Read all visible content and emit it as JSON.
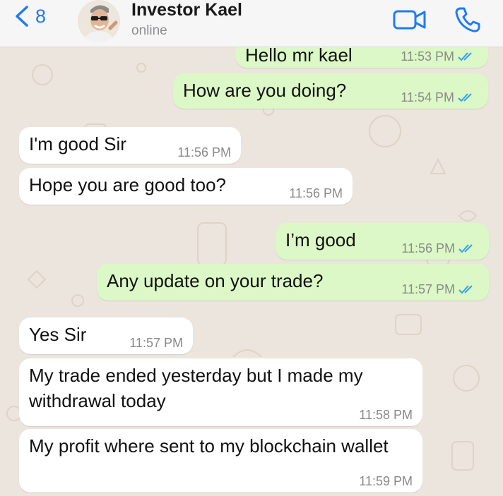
{
  "header": {
    "back_count": "8",
    "contact_name": "Investor Kael",
    "status": "online",
    "video_icon": "video-camera-icon",
    "call_icon": "phone-icon"
  },
  "colors": {
    "outgoing_bubble": "#dcf8c6",
    "incoming_bubble": "#ffffff",
    "read_tick": "#34a4eb",
    "accent": "#1e7cf6",
    "wallpaper": "#ece5dd"
  },
  "messages": [
    {
      "direction": "out",
      "text": "Hello mr kael",
      "time": "11:53 PM"
    },
    {
      "direction": "out",
      "text": "How are you doing?",
      "time": "11:54 PM"
    },
    {
      "direction": "in",
      "text": "I'm good Sir",
      "time": "11:56 PM"
    },
    {
      "direction": "in",
      "text": "Hope you are good too?",
      "time": "11:56 PM"
    },
    {
      "direction": "out",
      "text": "I’m good",
      "time": "11:56 PM"
    },
    {
      "direction": "out",
      "text": "Any update on your trade?",
      "time": "11:57 PM"
    },
    {
      "direction": "in",
      "text": "Yes Sir",
      "time": "11:57 PM"
    },
    {
      "direction": "in",
      "text": "My trade ended yesterday but I made my withdrawal today",
      "time": "11:58 PM"
    },
    {
      "direction": "in",
      "text": "My profit where sent to my blockchain wallet",
      "time": "11:59 PM"
    }
  ]
}
